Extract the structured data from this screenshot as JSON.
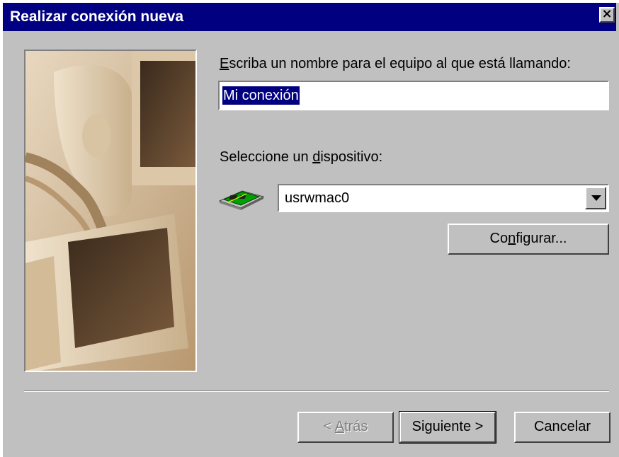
{
  "window": {
    "title": "Realizar conexión nueva",
    "close_glyph": "×"
  },
  "name_field": {
    "label_first": "E",
    "label_rest": "scriba un nombre para el equipo al que está llamando:",
    "value": "Mi conexión"
  },
  "device": {
    "label_before": "Seleccione un ",
    "label_underlined": "d",
    "label_after": "ispositivo:",
    "selected": "usrwmac0",
    "icon": "network-card-icon"
  },
  "buttons": {
    "configure_before": "Co",
    "configure_underlined": "n",
    "configure_after": "figurar...",
    "back_before": "< ",
    "back_underlined": "A",
    "back_after": "trás",
    "next": "Siguiente >",
    "cancel": "Cancelar"
  },
  "colors": {
    "titlebar": "#000080",
    "face": "#c0c0c0",
    "selection": "#000080"
  }
}
